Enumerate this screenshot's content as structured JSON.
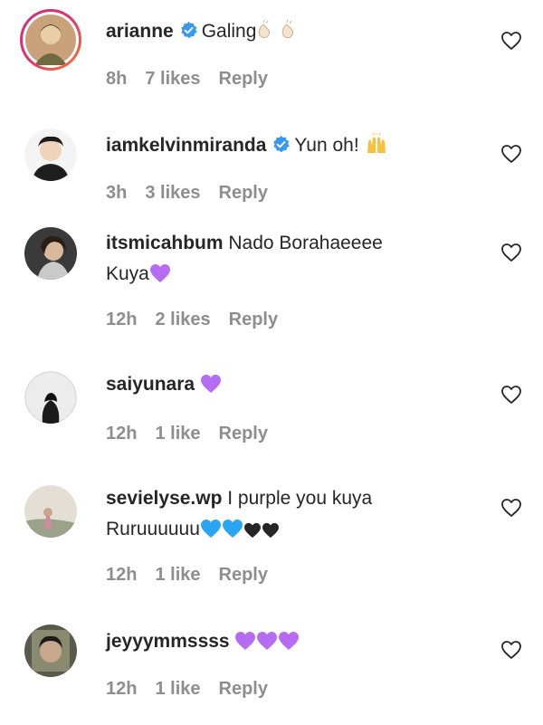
{
  "comments": [
    {
      "username": "arianne",
      "verified": true,
      "text": "Galing",
      "emoji": [
        "clapping-hands",
        "clapping-hands"
      ],
      "time": "8h",
      "likes": "7 likes",
      "reply": "Reply"
    },
    {
      "username": "iamkelvinmiranda",
      "verified": true,
      "text": "Yun oh!",
      "emoji": [
        "raising-hands"
      ],
      "time": "3h",
      "likes": "3 likes",
      "reply": "Reply"
    },
    {
      "username": "itsmicahbum",
      "verified": false,
      "text": "Nado Borahaeeee",
      "text_line2": "Kuya",
      "emoji": [
        "purple-heart"
      ],
      "time": "12h",
      "likes": "2 likes",
      "reply": "Reply"
    },
    {
      "username": "saiyunara",
      "verified": false,
      "text": "",
      "emoji": [
        "purple-heart"
      ],
      "time": "12h",
      "likes": "1 like",
      "reply": "Reply"
    },
    {
      "username": "sevielyse.wp",
      "verified": false,
      "text": "I purple you kuya",
      "text_line2": "Ruruuuuuu",
      "emoji": [
        "blue-heart",
        "blue-heart",
        "black-heart",
        "black-heart"
      ],
      "time": "12h",
      "likes": "1 like",
      "reply": "Reply"
    },
    {
      "username": "jeyyymmssss",
      "verified": false,
      "text": "",
      "emoji": [
        "purple-heart",
        "purple-heart",
        "purple-heart"
      ],
      "time": "12h",
      "likes": "1 like",
      "reply": "Reply"
    }
  ],
  "colors": {
    "verified_blue": "#3897f0",
    "meta_gray": "#8e8e8e",
    "purple_heart": "#b56cf3",
    "blue_heart": "#2aa5f5",
    "black_heart": "#262626"
  }
}
